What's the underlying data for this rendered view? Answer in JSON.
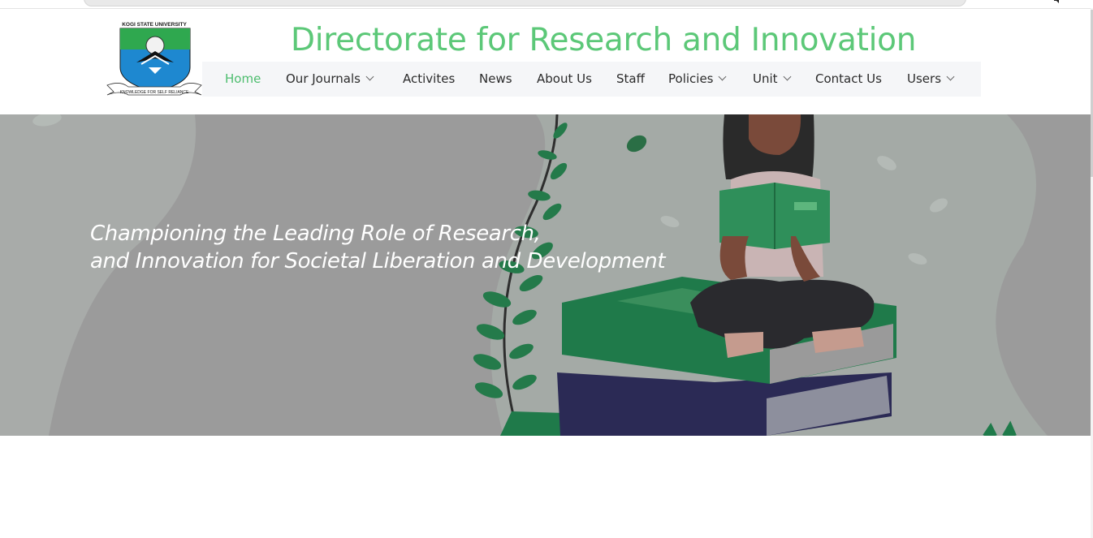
{
  "browser": {
    "tab_strip_icon": "speaker-icon"
  },
  "header": {
    "logo": {
      "top_text": "KOGI STATE UNIVERSITY",
      "motto": "KNOWLEDGE FOR SELF RELIANCE"
    },
    "title": "Directorate for Research and Innovation"
  },
  "nav": {
    "items": [
      {
        "label": "Home",
        "active": true,
        "has_dropdown": false
      },
      {
        "label": "Our Journals",
        "active": false,
        "has_dropdown": true
      },
      {
        "label": "Activites",
        "active": false,
        "has_dropdown": false
      },
      {
        "label": "News",
        "active": false,
        "has_dropdown": false
      },
      {
        "label": "About Us",
        "active": false,
        "has_dropdown": false
      },
      {
        "label": "Staff",
        "active": false,
        "has_dropdown": false
      },
      {
        "label": "Policies",
        "active": false,
        "has_dropdown": true
      },
      {
        "label": "Unit",
        "active": false,
        "has_dropdown": true
      },
      {
        "label": "Contact Us",
        "active": false,
        "has_dropdown": false
      },
      {
        "label": "Users",
        "active": false,
        "has_dropdown": true
      }
    ]
  },
  "hero": {
    "line1": "Championing the Leading Role of Research,",
    "line2": "and Innovation for Societal Liberation and Development",
    "illustration": "woman-reading-on-books-illustration"
  },
  "colors": {
    "accent": "#5cc878",
    "nav_active": "#4dbd6e",
    "hero_overlay": "#9b9b9b",
    "book_green": "#1f7a4a",
    "book_navy": "#2b2a55"
  }
}
